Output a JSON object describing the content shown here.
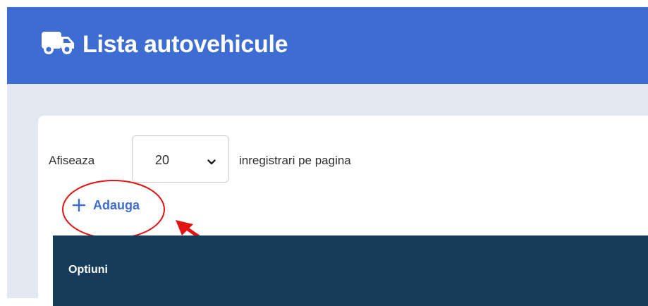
{
  "colors": {
    "header_bg": "#3d6cd3",
    "page_bg": "#e3e7ef",
    "accent": "#3d6cd3",
    "table_header_bg": "#173c5a",
    "annotation": "#e11414"
  },
  "header": {
    "icon": "truck-icon",
    "title": "Lista autovehicule"
  },
  "page_length": {
    "prefix_label": "Afiseaza",
    "selected_value": "20",
    "suffix_label": "inregistrari pe pagina"
  },
  "add_button": {
    "icon": "plus-icon",
    "label": "Adauga"
  },
  "table": {
    "columns": [
      "Optiuni"
    ]
  }
}
